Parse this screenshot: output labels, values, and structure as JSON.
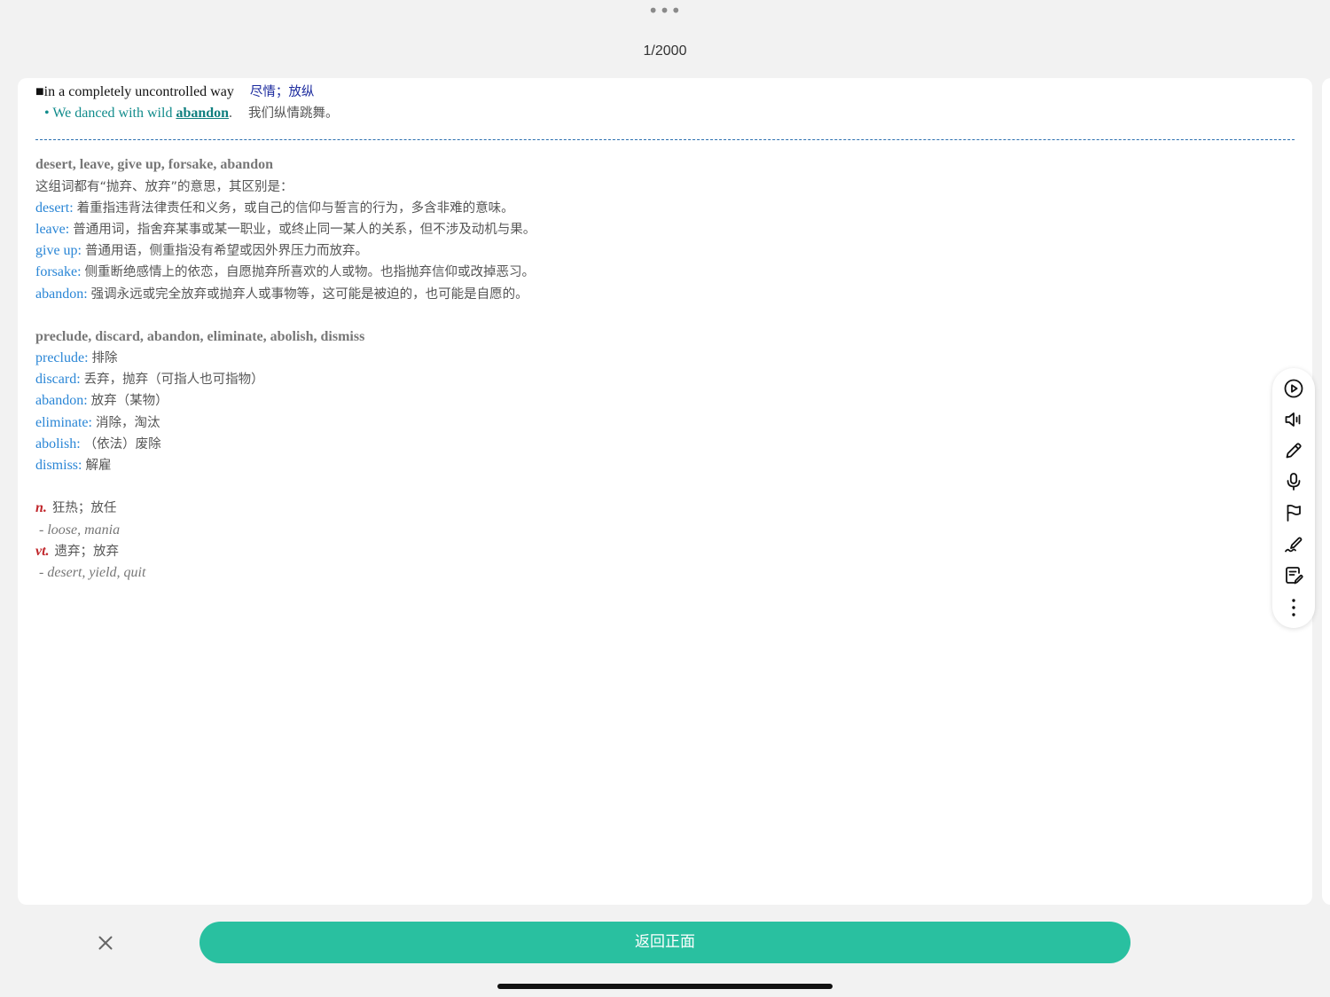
{
  "header": {
    "menu_glyph": "•••",
    "progress_text": "1/2000"
  },
  "card": {
    "sense": {
      "marker": "■",
      "en": "in a completely uncontrolled way",
      "zh": "尽情；放纵"
    },
    "example": {
      "bullet": "•",
      "before": "We danced with wild ",
      "keyword": "abandon",
      "after": ".",
      "zh": "我们纵情跳舞。"
    },
    "group1": {
      "heading": "desert, leave, give up, forsake, abandon",
      "intro": "这组词都有“抛弃、放弃”的意思，其区别是：",
      "items": [
        {
          "word": "desert",
          "sep": ": ",
          "text": "着重指违背法律责任和义务，或自己的信仰与誓言的行为，多含非难的意味。"
        },
        {
          "word": "leave",
          "sep": ": ",
          "text": "普通用词，指舍弃某事或某一职业，或终止同一某人的关系，但不涉及动机与果。"
        },
        {
          "word": "give up",
          "sep": ": ",
          "text": "普通用语，侧重指没有希望或因外界压力而放弃。"
        },
        {
          "word": "forsake",
          "sep": ": ",
          "text": "侧重断绝感情上的依恋，自愿抛弃所喜欢的人或物。也指抛弃信仰或改掉恶习。"
        },
        {
          "word": "abandon",
          "sep": ": ",
          "text": "强调永远或完全放弃或抛弃人或事物等，这可能是被迫的，也可能是自愿的。"
        }
      ]
    },
    "group2": {
      "heading": "preclude, discard, abandon, eliminate, abolish, dismiss",
      "items": [
        {
          "word": "preclude",
          "sep": ": ",
          "text": "排除"
        },
        {
          "word": "discard",
          "sep": ": ",
          "text": "丢弃，抛弃（可指人也可指物）"
        },
        {
          "word": "abandon",
          "sep": ": ",
          "text": "放弃（某物）"
        },
        {
          "word": "eliminate",
          "sep": ": ",
          "text": "消除，淘汰"
        },
        {
          "word": "abolish",
          "sep": ": ",
          "text": "（依法）废除"
        },
        {
          "word": "dismiss",
          "sep": ": ",
          "text": "解雇"
        }
      ]
    },
    "pos_entries": [
      {
        "pos": "n.",
        "meaning": "狂热；放任",
        "synonyms": "- loose, mania"
      },
      {
        "pos": "vt.",
        "meaning": "遗弃；放弃",
        "synonyms": "- desert, yield, quit"
      }
    ]
  },
  "toolbar": {
    "tools": [
      "play-icon",
      "speaker-icon",
      "pencil-icon",
      "microphone-icon",
      "flag-icon",
      "handwriting-icon",
      "note-edit-icon",
      "more-vertical-icon"
    ]
  },
  "footer": {
    "close_glyph": "×",
    "back_label": "返回正面"
  },
  "colors": {
    "accent": "#29c0a0",
    "word_blue": "#2a86d6",
    "pos_red": "#c0262b",
    "example_teal": "#128c8c"
  }
}
